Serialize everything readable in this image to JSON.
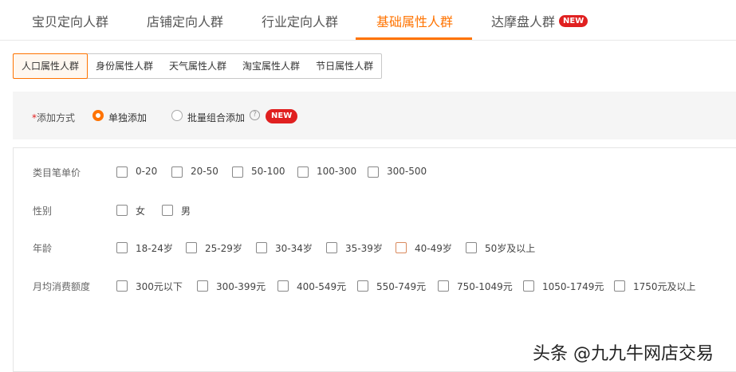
{
  "top_tabs": [
    "宝贝定向人群",
    "店铺定向人群",
    "行业定向人群",
    "基础属性人群",
    "达摩盘人群"
  ],
  "new_badge": "NEW",
  "sub_tabs": [
    "人口属性人群",
    "身份属性人群",
    "天气属性人群",
    "淘宝属性人群",
    "节日属性人群"
  ],
  "add_method": {
    "required_mark": "*",
    "label": "添加方式",
    "option_single": "单独添加",
    "option_batch": "批量组合添加",
    "help_glyph": "?"
  },
  "filters": {
    "price": {
      "label": "类目笔单价",
      "options": [
        "0-20",
        "20-50",
        "50-100",
        "100-300",
        "300-500"
      ]
    },
    "gender": {
      "label": "性别",
      "options": [
        "女",
        "男"
      ]
    },
    "age": {
      "label": "年龄",
      "options": [
        "18-24岁",
        "25-29岁",
        "30-34岁",
        "35-39岁",
        "40-49岁",
        "50岁及以上"
      ]
    },
    "spend": {
      "label": "月均消费额度",
      "options": [
        "300元以下",
        "300-399元",
        "400-549元",
        "550-749元",
        "750-1049元",
        "1050-1749元",
        "1750元及以上"
      ]
    }
  },
  "watermark": "头条 @九九牛网店交易",
  "colors": {
    "accent": "#ff7300",
    "badge": "#e02020"
  }
}
